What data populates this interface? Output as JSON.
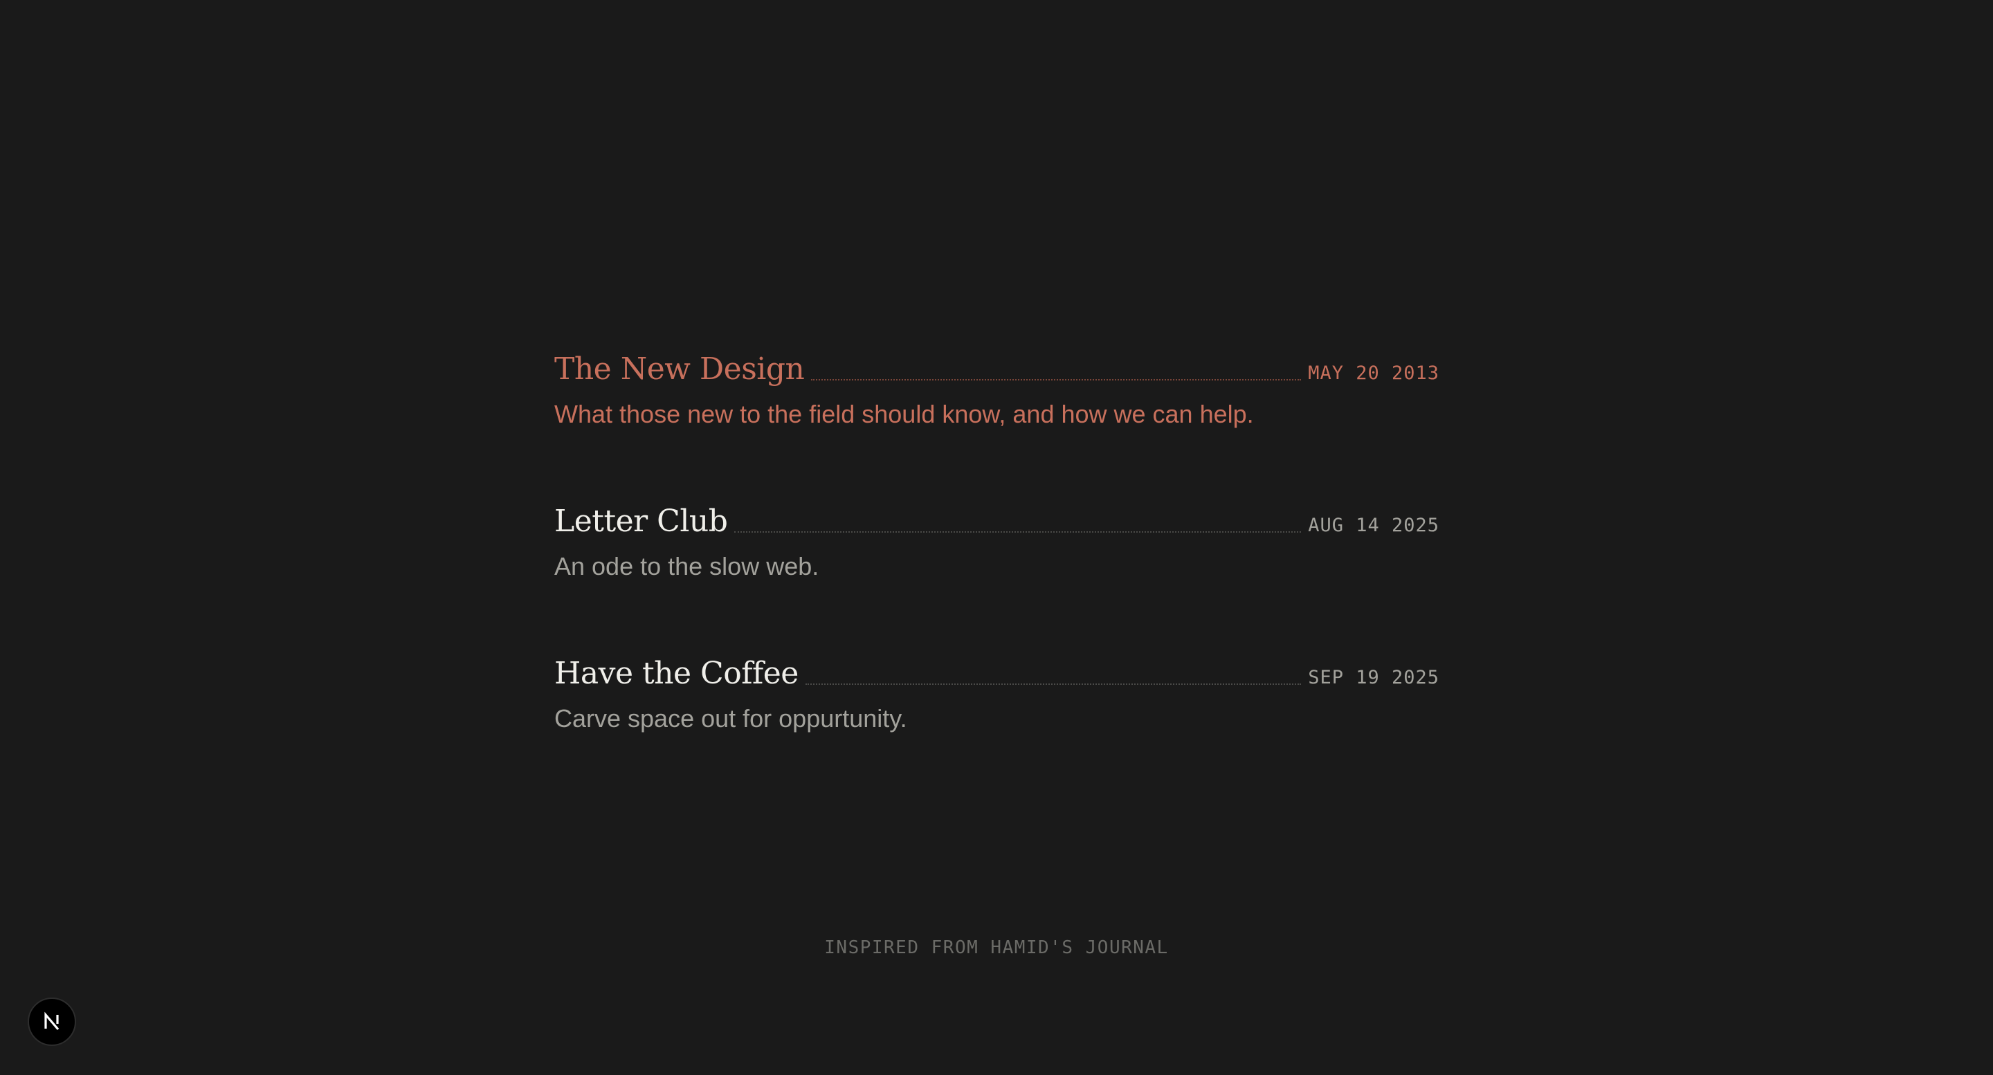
{
  "posts": [
    {
      "title": "The New Design",
      "date": "MAY 20 2013",
      "description": "What those new to the field should know, and how we can help.",
      "active": true
    },
    {
      "title": "Letter Club",
      "date": "AUG 14 2025",
      "description": "An ode to the slow web.",
      "active": false
    },
    {
      "title": "Have the Coffee",
      "date": "SEP 19 2025",
      "description": "Carve space out for oppurtunity.",
      "active": false
    }
  ],
  "footer": {
    "text": "INSPIRED FROM HAMID'S JOURNAL"
  },
  "badge": {
    "icon": "nextjs-logo-icon",
    "letter": "N"
  },
  "colors": {
    "background": "#1a1a1a",
    "accent": "#c8705c",
    "title": "#f0efea",
    "muted": "#a3a29c",
    "footer": "#6b6b67"
  }
}
